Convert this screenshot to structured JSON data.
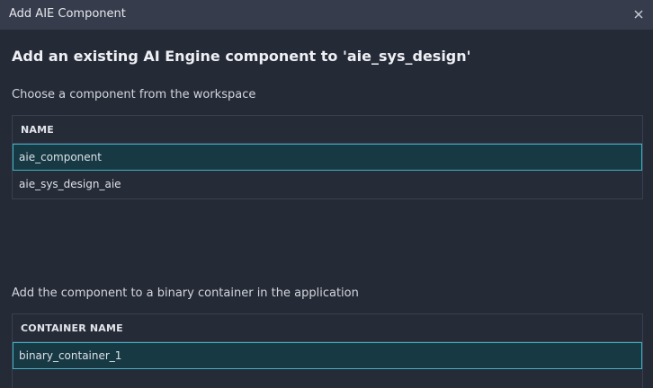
{
  "dialog": {
    "title": "Add AIE Component",
    "close_icon": "close-icon"
  },
  "heading": "Add an existing AI Engine component to 'aie_sys_design'",
  "component_section": {
    "label": "Choose a component from the workspace",
    "column_header": "NAME",
    "rows": [
      {
        "name": "aie_component",
        "selected": true
      },
      {
        "name": "aie_sys_design_aie",
        "selected": false
      }
    ]
  },
  "container_section": {
    "label": "Add the component to a binary container in the application",
    "column_header": "CONTAINER NAME",
    "rows": [
      {
        "name": "binary_container_1",
        "selected": true
      }
    ]
  },
  "colors": {
    "background": "#252a37",
    "titlebar": "#363c4b",
    "selection_fill": "#173944",
    "selection_border": "#3fb3c4"
  }
}
